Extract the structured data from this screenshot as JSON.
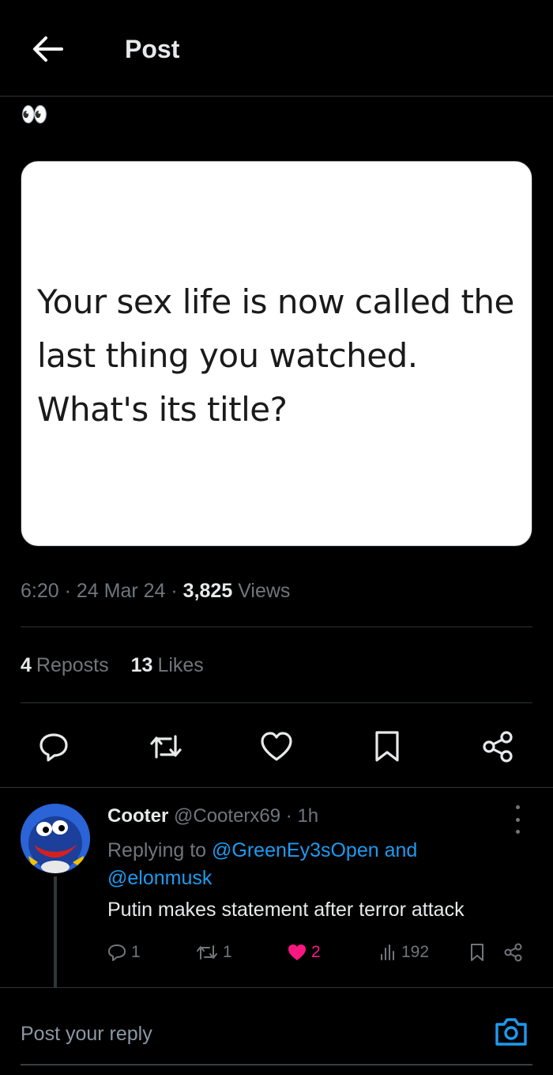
{
  "header": {
    "title": "Post"
  },
  "post": {
    "text": "👀",
    "image_text": "Your sex life is now called the last thing you watched. What's its title?",
    "time": "6:20",
    "date": "24 Mar 24",
    "views_count": "3,825",
    "views_label": "Views",
    "reposts_count": "4",
    "reposts_label": "Reposts",
    "likes_count": "13",
    "likes_label": "Likes"
  },
  "reply": {
    "name": "Cooter",
    "handle": "@Cooterx69",
    "age": "1h",
    "replying_prefix": "Replying to",
    "mention_1": "@GreenEy3sOpen",
    "mention_and": "and",
    "mention_2": "@elonmusk",
    "text": "Putin makes statement after terror attack",
    "comments": "1",
    "reposts": "1",
    "likes": "2",
    "views": "192"
  },
  "composer": {
    "placeholder": "Post your reply"
  },
  "colors": {
    "background": "#000000",
    "accent": "#1d9bf0",
    "like_active": "#f91880",
    "muted": "#71767b"
  },
  "icons": [
    "back-arrow-icon",
    "reply-icon",
    "repost-icon",
    "like-icon",
    "bookmark-icon",
    "share-icon",
    "more-icon",
    "views-icon",
    "camera-icon"
  ]
}
